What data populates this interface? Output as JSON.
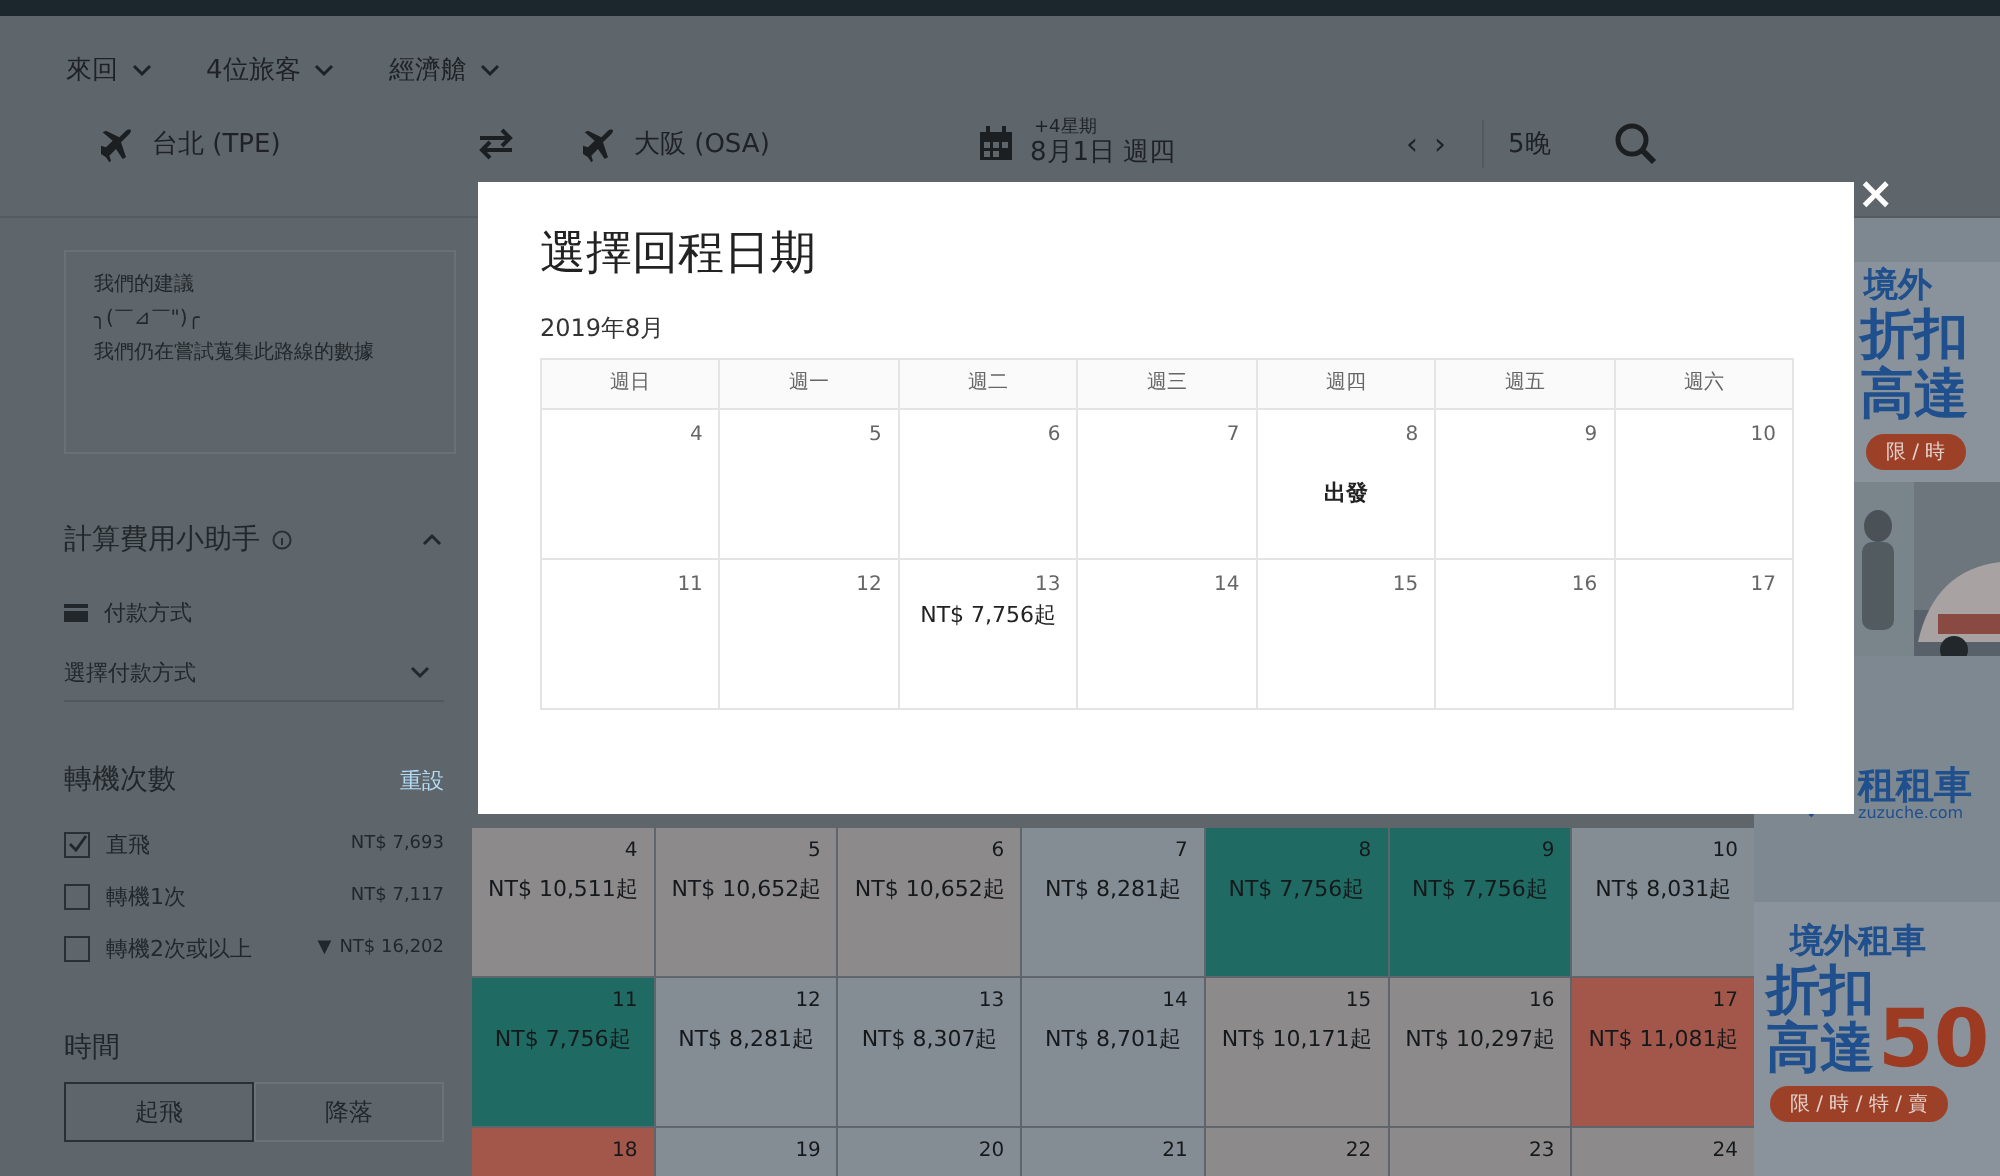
{
  "header": {
    "filters": [
      {
        "label": "來回"
      },
      {
        "label": "4位旅客"
      },
      {
        "label": "經濟艙"
      }
    ],
    "origin": "台北 (TPE)",
    "destination": "大阪 (OSA)",
    "date_hint": "+4星期",
    "date": "8月1日 週四",
    "prev": "‹",
    "next": "›",
    "nights": "5晚"
  },
  "sidebar": {
    "suggestion": {
      "title": "我們的建議",
      "emoticon": "╮(￣⊿￣\")╭",
      "message": "我們仍在嘗試蒐集此路線的數據"
    },
    "fee_helper": {
      "title": "計算費用小助手",
      "expanded": true,
      "payment_label": "付款方式",
      "payment_placeholder": "選擇付款方式"
    },
    "stops": {
      "title": "轉機次數",
      "reset": "重設",
      "options": [
        {
          "label": "直飛",
          "price": "NT$ 7,693",
          "checked": true
        },
        {
          "label": "轉機1次",
          "price": "NT$ 7,117",
          "checked": false
        },
        {
          "label": "轉機2次或以上",
          "trend_icon": "▼",
          "price": "NT$ 16,202",
          "checked": false
        }
      ]
    },
    "time": {
      "title": "時間",
      "tabs": [
        {
          "label": "起飛",
          "selected": true
        },
        {
          "label": "降落",
          "selected": false
        }
      ]
    }
  },
  "price_calendar": {
    "weeks": [
      [
        {
          "day": "4",
          "price": "NT$ 10,511起",
          "color": "#8d8a8b"
        },
        {
          "day": "5",
          "price": "NT$ 10,652起",
          "color": "#8d8a8b"
        },
        {
          "day": "6",
          "price": "NT$ 10,652起",
          "color": "#8d8a8b"
        },
        {
          "day": "7",
          "price": "NT$ 8,281起",
          "color": "#838d93"
        },
        {
          "day": "8",
          "price": "NT$ 7,756起",
          "color": "#1f6b63"
        },
        {
          "day": "9",
          "price": "NT$ 7,756起",
          "color": "#1f6b63"
        },
        {
          "day": "10",
          "price": "NT$ 8,031起",
          "color": "#838d93"
        }
      ],
      [
        {
          "day": "11",
          "price": "NT$ 7,756起",
          "color": "#1f6b63"
        },
        {
          "day": "12",
          "price": "NT$ 8,281起",
          "color": "#838d93"
        },
        {
          "day": "13",
          "price": "NT$ 8,307起",
          "color": "#838d93"
        },
        {
          "day": "14",
          "price": "NT$ 8,701起",
          "color": "#838d93"
        },
        {
          "day": "15",
          "price": "NT$ 10,171起",
          "color": "#8d8a8b"
        },
        {
          "day": "16",
          "price": "NT$ 10,297起",
          "color": "#8d8a8b"
        },
        {
          "day": "17",
          "price": "NT$ 11,081起",
          "color": "#a3574b"
        }
      ],
      [
        {
          "day": "18",
          "color": "#a3574b"
        },
        {
          "day": "19",
          "color": "#838d93"
        },
        {
          "day": "20",
          "color": "#838d93"
        },
        {
          "day": "21",
          "color": "#838d93"
        },
        {
          "day": "22",
          "color": "#8d8a8b"
        },
        {
          "day": "23",
          "color": "#8d8a8b"
        },
        {
          "day": "24",
          "color": "#8d8a8b"
        }
      ]
    ]
  },
  "ads": {
    "top": {
      "heading": "境外",
      "line1": "折扣",
      "line2": "高達",
      "pill": "限 / 時"
    },
    "logo": {
      "name": "租租車",
      "url": "zuzuche.com"
    },
    "bottom": {
      "heading": "境外租車",
      "line1": "折扣",
      "line2": "高達",
      "number": "50",
      "pill": "限 / 時 / 特 / 賣"
    }
  },
  "modal": {
    "title": "選擇回程日期",
    "month": "2019年8月",
    "close": "×",
    "weekdays": [
      "週日",
      "週一",
      "週二",
      "週三",
      "週四",
      "週五",
      "週六"
    ],
    "weeks": [
      [
        {
          "day": "4"
        },
        {
          "day": "5"
        },
        {
          "day": "6"
        },
        {
          "day": "7"
        },
        {
          "day": "8",
          "note": "出發"
        },
        {
          "day": "9"
        },
        {
          "day": "10"
        }
      ],
      [
        {
          "day": "11"
        },
        {
          "day": "12"
        },
        {
          "day": "13",
          "price": "NT$ 7,756起"
        },
        {
          "day": "14"
        },
        {
          "day": "15"
        },
        {
          "day": "16"
        },
        {
          "day": "17"
        }
      ]
    ]
  }
}
